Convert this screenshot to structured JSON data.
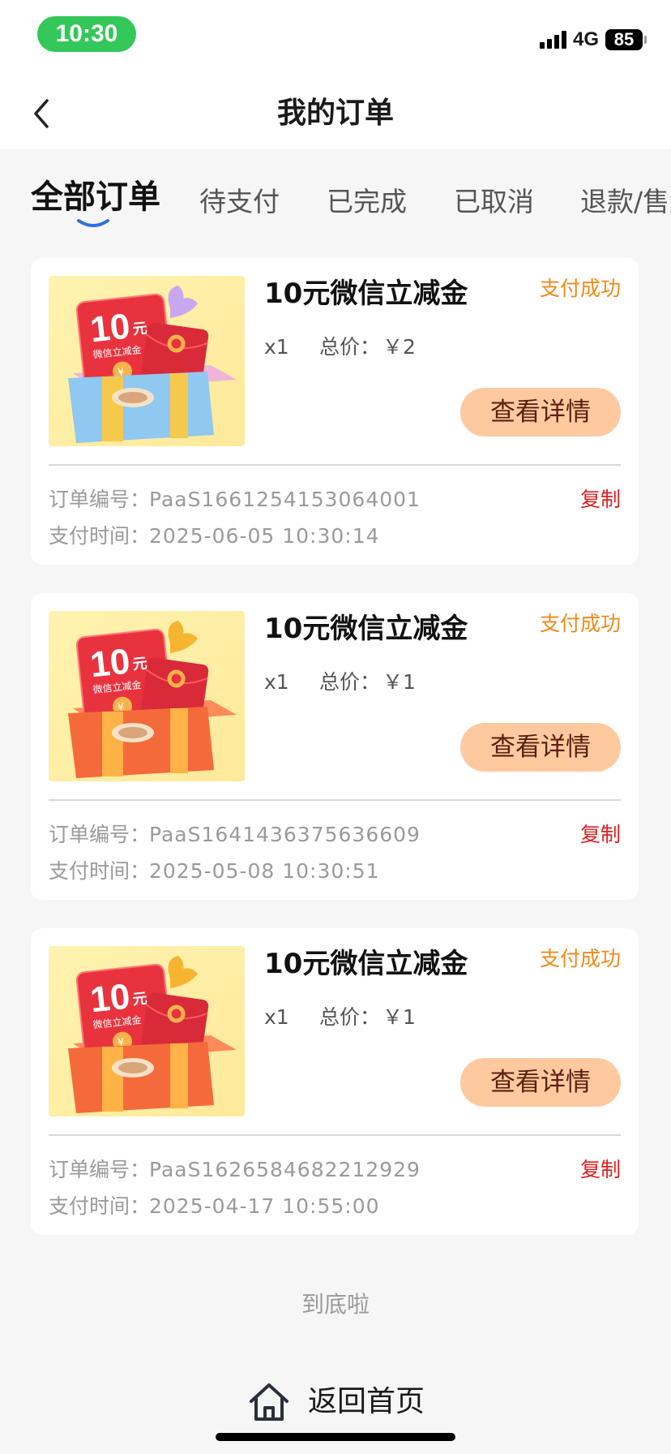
{
  "status_bar": {
    "time": "10:30",
    "network": "4G",
    "battery": "85"
  },
  "nav": {
    "title": "我的订单"
  },
  "tabs": [
    {
      "label": "全部订单",
      "active": true
    },
    {
      "label": "待支付",
      "active": false
    },
    {
      "label": "已完成",
      "active": false
    },
    {
      "label": "已取消",
      "active": false
    },
    {
      "label": "退款/售后",
      "active": false
    }
  ],
  "labels": {
    "order_no_label": "订单编号：",
    "pay_time_label": "支付时间：",
    "price_label": "总价：",
    "copy": "复制",
    "detail_button": "查看详情",
    "thumb_amount": "10",
    "thumb_unit": "元",
    "thumb_sub": "微信立减金"
  },
  "orders": [
    {
      "title": "10元微信立减金",
      "status": "支付成功",
      "qty": "x1",
      "price": "￥2",
      "order_no": "PaaS1661254153064001",
      "pay_time": "2025-06-05 10:30:14",
      "thumb_variant": "blue"
    },
    {
      "title": "10元微信立减金",
      "status": "支付成功",
      "qty": "x1",
      "price": "￥1",
      "order_no": "PaaS1641436375636609",
      "pay_time": "2025-05-08 10:30:51",
      "thumb_variant": "orange"
    },
    {
      "title": "10元微信立减金",
      "status": "支付成功",
      "qty": "x1",
      "price": "￥1",
      "order_no": "PaaS1626584682212929",
      "pay_time": "2025-04-17 10:55:00",
      "thumb_variant": "orange"
    }
  ],
  "footer": {
    "end_text": "到底啦",
    "home_label": "返回首页"
  },
  "colors": {
    "status_orange": "#f08a1a",
    "copy_red": "#e02020",
    "button_bg": "#ffc9a0",
    "button_text": "#5a1f0e",
    "time_pill": "#34c759"
  }
}
